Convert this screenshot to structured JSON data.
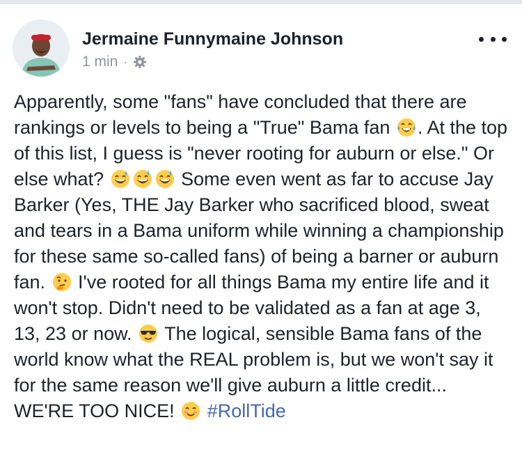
{
  "post": {
    "author": "Jermaine Funnymaine Johnson",
    "time": "1 min",
    "separator": "·",
    "privacy_icon": "gear-icon",
    "more_icon": "more-options-icon",
    "segments": [
      {
        "type": "text",
        "value": "Apparently, some \"fans\" have concluded that there are rankings or levels to being a \"True\" Bama fan "
      },
      {
        "type": "emoji",
        "value": "laugh-tears-emoji"
      },
      {
        "type": "text",
        "value": ". At the top of this list, I guess is \"never rooting for auburn or else.\" Or else what? "
      },
      {
        "type": "emoji",
        "value": "sweat-smile-emoji"
      },
      {
        "type": "emoji",
        "value": "sweat-smile-emoji"
      },
      {
        "type": "emoji",
        "value": "sweat-smile-emoji"
      },
      {
        "type": "text",
        "value": " Some even went as far to accuse Jay Barker (Yes, THE Jay Barker who sacrificed blood, sweat and tears in a Bama uniform while winning a championship for these same so-called fans) of being a barner or auburn fan. "
      },
      {
        "type": "emoji",
        "value": "thinking-emoji"
      },
      {
        "type": "text",
        "value": " I've rooted for all things Bama my entire life and it won't stop. Didn't need to be validated as a fan at age 3, 13, 23 or now. "
      },
      {
        "type": "emoji",
        "value": "sunglasses-emoji"
      },
      {
        "type": "text",
        "value": " The logical, sensible Bama fans of the world know what the REAL problem is, but we won't say it for the same reason we'll give auburn a little credit... WE'RE TOO NICE! "
      },
      {
        "type": "emoji",
        "value": "smiling-blush-emoji"
      },
      {
        "type": "text",
        "value": " "
      },
      {
        "type": "hashtag",
        "value": "#RollTide"
      }
    ]
  },
  "colors": {
    "text": "#1d2129",
    "meta": "#90949c",
    "hashtag": "#4267b2",
    "emoji_face": "#ffcc4d"
  }
}
